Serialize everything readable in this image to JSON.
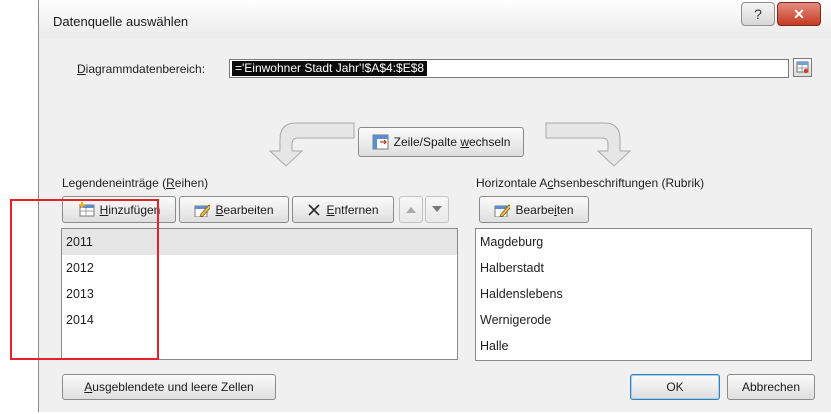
{
  "dialog": {
    "title": "Datenquelle auswählen",
    "help_glyph": "?",
    "close_glyph": "✕"
  },
  "range": {
    "label_prefix": "D",
    "label_rest": "iagrammdatenbereich:",
    "value": "='Einwohner Stadt Jahr'!$A$4:$E$8"
  },
  "switch_button": {
    "label_before": "Zeile/Spalte ",
    "label_under": "w",
    "label_after": "echseln"
  },
  "series": {
    "heading_before": "Legendeneinträge (",
    "heading_under": "R",
    "heading_after": "eihen)",
    "add": {
      "under": "H",
      "rest": "inzufügen"
    },
    "edit": {
      "under": "B",
      "rest": "earbeiten"
    },
    "remove": {
      "under": "E",
      "rest": "ntfernen"
    },
    "items": [
      "2011",
      "2012",
      "2013",
      "2014"
    ],
    "selected_index": 0
  },
  "categories": {
    "heading_before": "Horizontale A",
    "heading_under": "c",
    "heading_after": "hsenbeschriftungen (Rubrik)",
    "edit": {
      "before": "Bearbe",
      "under": "i",
      "after": "ten"
    },
    "items": [
      "Magdeburg",
      "Halberstadt",
      "Haldenslebens",
      "Wernigerode",
      "Halle"
    ]
  },
  "footer": {
    "hidden_cells": {
      "under": "A",
      "rest": "usgeblendete und leere Zellen"
    },
    "ok": "OK",
    "cancel": "Abbrechen"
  },
  "colors": {
    "highlight_box": "#e8202a",
    "selection_bg": "#0b0b0b",
    "close_button": "#c53a22"
  }
}
